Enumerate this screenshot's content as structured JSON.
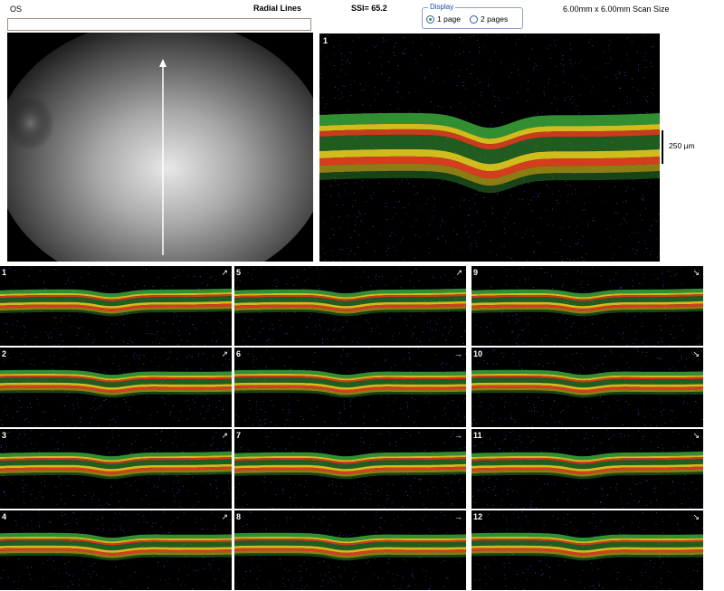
{
  "header": {
    "eye": "OS",
    "scan_type": "Radial Lines",
    "ssi": "SSI= 65.2",
    "scan_size": "6.00mm x 6.00mm Scan Size"
  },
  "display": {
    "legend": "Display",
    "options": [
      {
        "label": "1 page",
        "selected": true
      },
      {
        "label": "2 pages",
        "selected": false
      }
    ]
  },
  "main_scan": {
    "number": "1",
    "scale_label": "250 µm"
  },
  "thumbnails": [
    {
      "number": "1",
      "arrow": "↗"
    },
    {
      "number": "5",
      "arrow": "↗"
    },
    {
      "number": "9",
      "arrow": "↘"
    },
    {
      "number": "2",
      "arrow": "↗"
    },
    {
      "number": "6",
      "arrow": "→"
    },
    {
      "number": "10",
      "arrow": "↘"
    },
    {
      "number": "3",
      "arrow": "↗"
    },
    {
      "number": "7",
      "arrow": "→"
    },
    {
      "number": "11",
      "arrow": "↘"
    },
    {
      "number": "4",
      "arrow": "↗"
    },
    {
      "number": "8",
      "arrow": "→"
    },
    {
      "number": "12",
      "arrow": "↘"
    }
  ],
  "colors": {
    "retina_green": "#3aa83a",
    "retina_yellow": "#e8d020",
    "retina_red": "#e04020",
    "noise": "#3a4fb0"
  }
}
